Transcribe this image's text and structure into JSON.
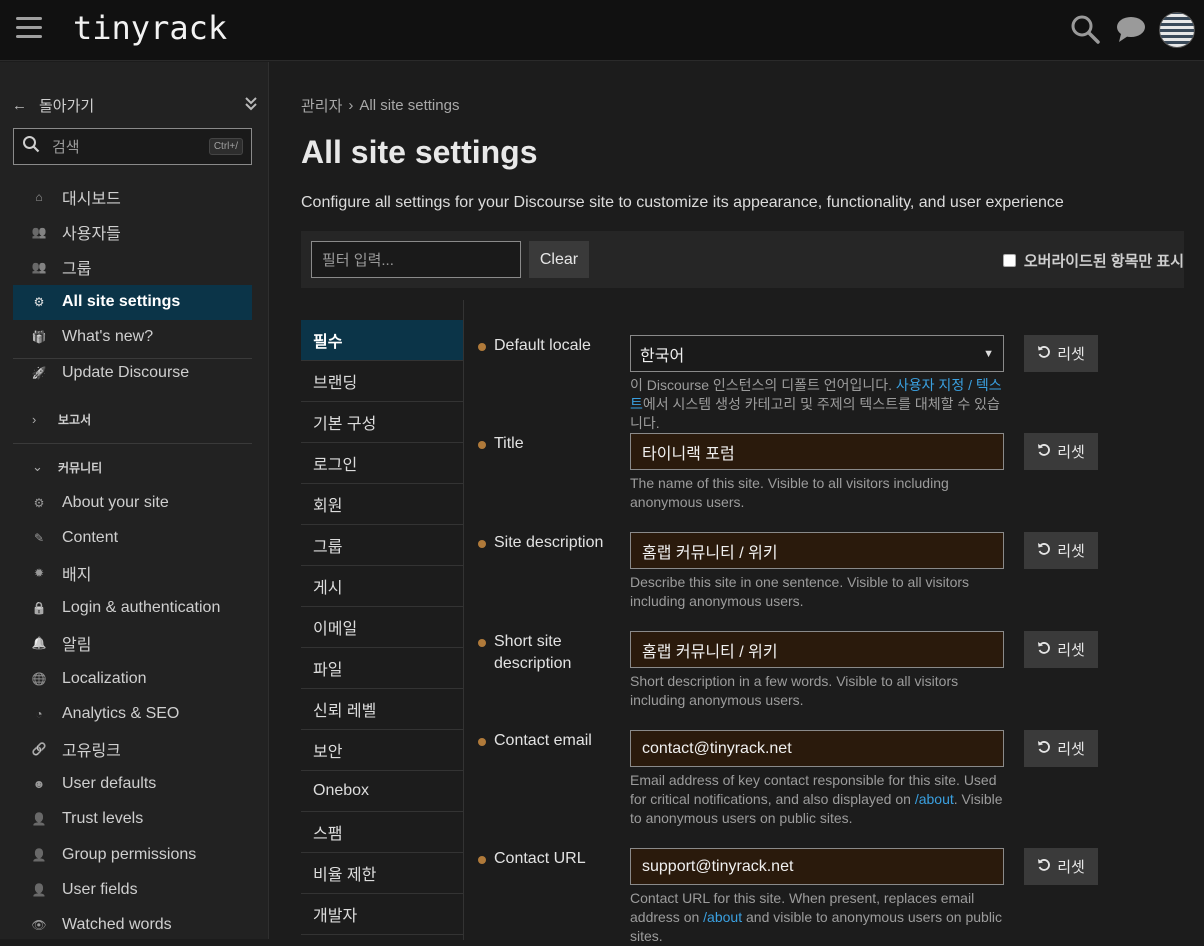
{
  "header": {
    "logo": "tinyrack"
  },
  "sidebar": {
    "back_label": "돌아가기",
    "search_placeholder": "검색",
    "search_shortcut": "Ctrl+/",
    "items_top": [
      {
        "label": "대시보드",
        "icon": "home-icon"
      },
      {
        "label": "사용자들",
        "icon": "users-icon"
      },
      {
        "label": "그룹",
        "icon": "group-icon"
      },
      {
        "label": "All site settings",
        "icon": "gear-icon",
        "active": true
      },
      {
        "label": "What's new?",
        "icon": "gift-icon"
      },
      {
        "label": "Update Discourse",
        "icon": "rocket-icon"
      }
    ],
    "section_reports": "보고서",
    "section_community": "커뮤니티",
    "items_community": [
      {
        "label": "About your site",
        "icon": "gear-icon"
      },
      {
        "label": "Content",
        "icon": "pencil-icon"
      },
      {
        "label": "배지",
        "icon": "badge-icon"
      },
      {
        "label": "Login & authentication",
        "icon": "lock-icon"
      },
      {
        "label": "알림",
        "icon": "bell-icon"
      },
      {
        "label": "Localization",
        "icon": "globe-icon"
      },
      {
        "label": "Analytics & SEO",
        "icon": "pie-chart-icon"
      },
      {
        "label": "고유링크",
        "icon": "link-icon"
      },
      {
        "label": "User defaults",
        "icon": "user-circle-icon"
      },
      {
        "label": "Trust levels",
        "icon": "user-shield-icon"
      },
      {
        "label": "Group permissions",
        "icon": "user-gear-icon"
      },
      {
        "label": "User fields",
        "icon": "user-check-icon"
      },
      {
        "label": "Watched words",
        "icon": "eye-icon"
      }
    ]
  },
  "main": {
    "breadcrumb_parent": "관리자",
    "breadcrumb_sep": "›",
    "breadcrumb_current": "All site settings",
    "title": "All site settings",
    "description": "Configure all settings for your Discourse site to customize its appearance, functionality, and user experience",
    "filter_placeholder": "필터 입력...",
    "clear_label": "Clear",
    "only_overridden_label": "오버라이드된 항목만 표시",
    "categories": [
      "필수",
      "브랜딩",
      "기본 구성",
      "로그인",
      "회원",
      "그룹",
      "게시",
      "이메일",
      "파일",
      "신뢰 레벨",
      "보안",
      "Onebox",
      "스팸",
      "비율 제한",
      "개발자"
    ],
    "reset_label": "리셋",
    "settings": [
      {
        "label": "Default locale",
        "value": "한국어",
        "help_pre": "이 Discourse 인스턴스의 디폴트 언어입니다. ",
        "help_link": "사용자 지정 / 텍스트",
        "help_post": "에서 시스템 생성 카테고리 및 주제의 텍스트를 대체할 수 있습니다."
      },
      {
        "label": "Title",
        "value": "타이니랙 포럼",
        "help_pre": "The name of this site. Visible to all visitors including anonymous users."
      },
      {
        "label": "Site description",
        "value": "홈랩 커뮤니티 / 위키",
        "help_pre": "Describe this site in one sentence. Visible to all visitors including anonymous users."
      },
      {
        "label": "Short site description",
        "value": "홈랩 커뮤니티 / 위키",
        "help_pre": "Short description in a few words. Visible to all visitors including anonymous users."
      },
      {
        "label": "Contact email",
        "value": "contact@tinyrack.net",
        "help_pre": "Email address of key contact responsible for this site. Used for critical notifications, and also displayed on ",
        "help_link": "/about",
        "help_post": ". Visible to anonymous users on public sites."
      },
      {
        "label": "Contact URL",
        "value": "support@tinyrack.net",
        "help_pre": "Contact URL for this site. When present, replaces email address on ",
        "help_link": "/about",
        "help_post": " and visible to anonymous users on public sites."
      }
    ]
  }
}
